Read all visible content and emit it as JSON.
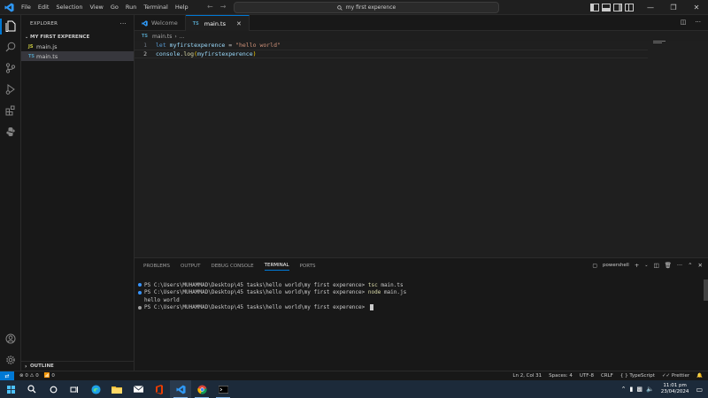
{
  "menu": [
    "File",
    "Edit",
    "Selection",
    "View",
    "Go",
    "Run",
    "Terminal",
    "Help"
  ],
  "search": {
    "text": "my first experence"
  },
  "explorer": {
    "title": "EXPLORER",
    "folder": "MY FIRST EXPERENCE",
    "files": [
      {
        "icon": "JS",
        "name": "main.js"
      },
      {
        "icon": "TS",
        "name": "main.ts"
      }
    ],
    "outline": "OUTLINE"
  },
  "tabs": [
    {
      "name": "Welcome"
    },
    {
      "icon": "TS",
      "name": "main.ts"
    }
  ],
  "breadcrumb": {
    "icon": "TS",
    "file": "main.ts",
    "rest": "..."
  },
  "editor": {
    "line_numbers": [
      "1",
      "2"
    ],
    "line1": {
      "kw": "let",
      "var": "myfirstexperence",
      "op": " = ",
      "str": "\"hello world\""
    },
    "line2": {
      "obj": "console",
      "dot": ".",
      "fn": "log",
      "open": "(",
      "arg": "myfirstexperence",
      "close": ")"
    }
  },
  "panel": {
    "tabs": [
      "PROBLEMS",
      "OUTPUT",
      "DEBUG CONSOLE",
      "TERMINAL",
      "PORTS"
    ],
    "shell": "powershell",
    "lines": [
      {
        "prompt": "PS C:\\Users\\MUHAMMAD\\Desktop\\45 tasks\\hello world\\my first experence> ",
        "cmd": "tsc",
        "args": " main.ts"
      },
      {
        "prompt": "PS C:\\Users\\MUHAMMAD\\Desktop\\45 tasks\\hello world\\my first experence> ",
        "cmd": "node",
        "args": " main.js"
      },
      {
        "output": "hello world"
      },
      {
        "prompt": "PS C:\\Users\\MUHAMMAD\\Desktop\\45 tasks\\hello world\\my first experence> "
      }
    ]
  },
  "status": {
    "errors": "0",
    "warnings": "0",
    "ports": "0",
    "position": "Ln 2, Col 31",
    "spaces": "Spaces: 4",
    "encoding": "UTF-8",
    "eol": "CRLF",
    "language": "TypeScript",
    "prettier": "Prettier"
  },
  "taskbar": {
    "time": "11:01 pm",
    "date": "23/04/2024"
  },
  "colors": {
    "accent": "#0078d4",
    "editor_bg": "#1f1f1f",
    "sidebar_bg": "#181818",
    "taskbar_bg": "#1c2a3a"
  }
}
